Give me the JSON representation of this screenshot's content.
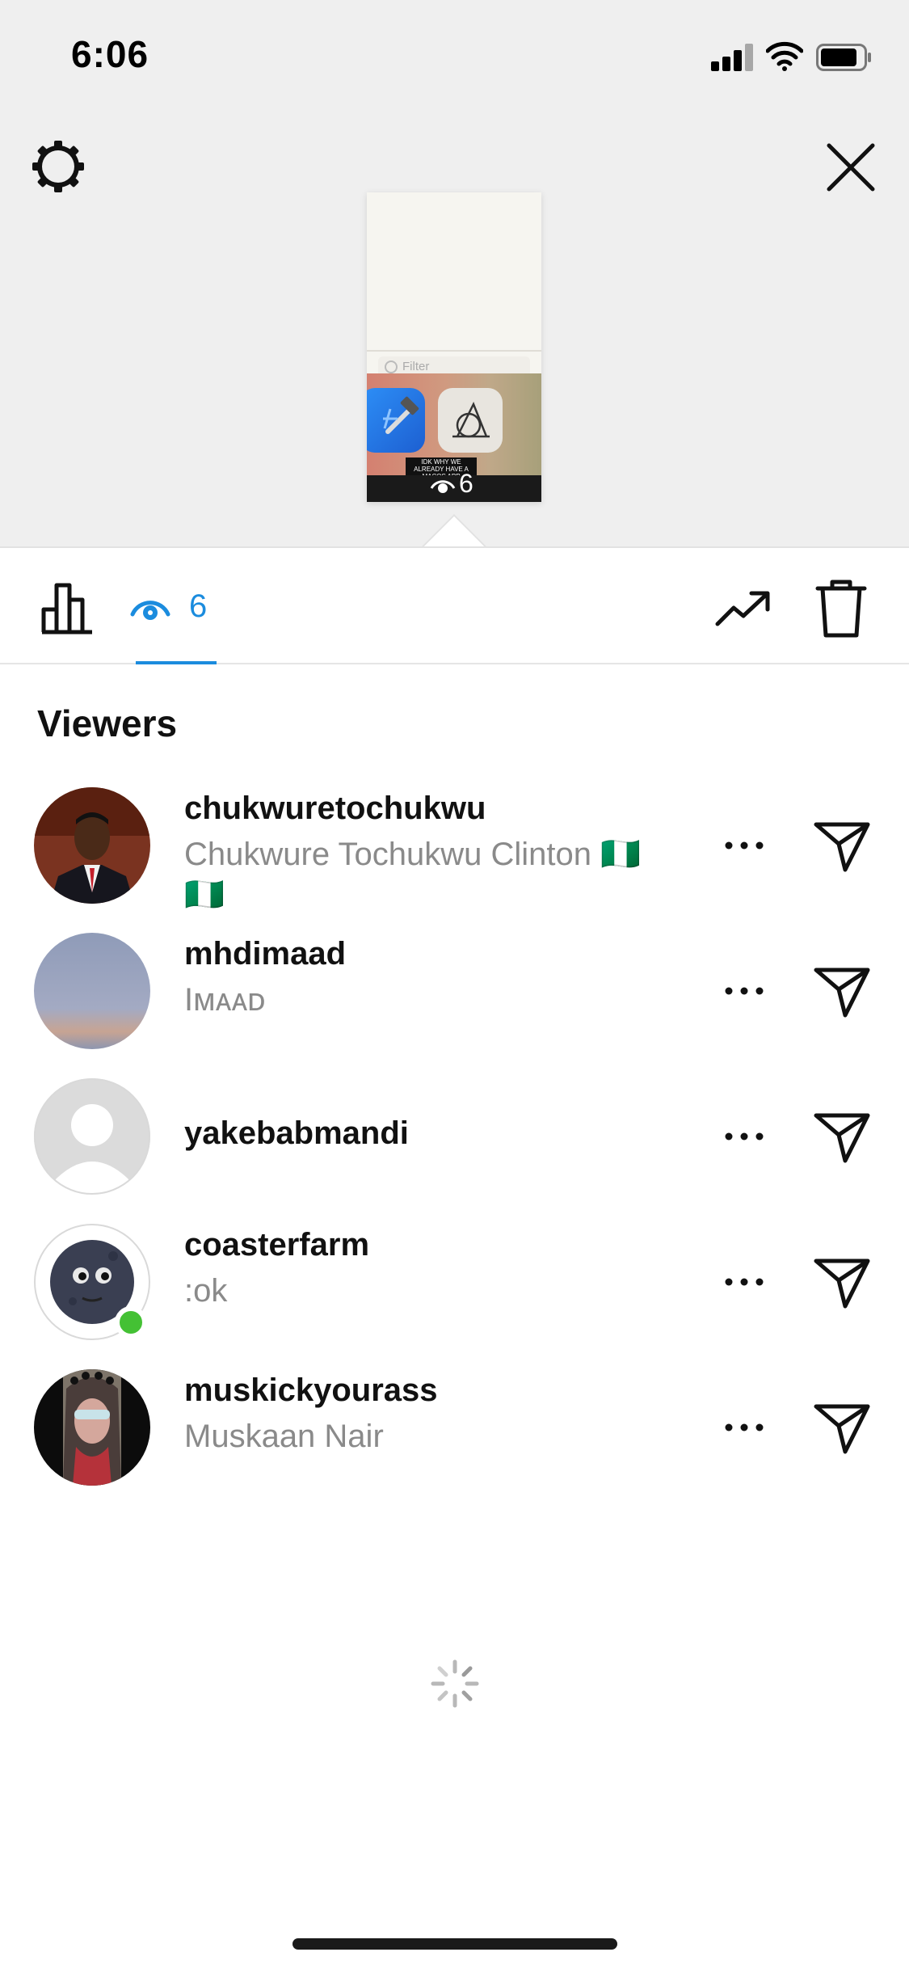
{
  "status_bar": {
    "time": "6:06"
  },
  "header": {
    "settings_icon": "gear-icon",
    "close_icon": "close-icon"
  },
  "story_preview": {
    "filter_placeholder": "Filter",
    "caption": "IDK WHY WE ALREADY HAVE A MACOS APP",
    "view_count": "6"
  },
  "tabs": {
    "viewers_count": "6",
    "active_color": "#1b8cde"
  },
  "viewers": {
    "title": "Viewers",
    "items": [
      {
        "username": "chukwuretochukwu",
        "full_name": "Chukwure Tochukwu Clinton 🇳🇬 🇳🇬",
        "online": false
      },
      {
        "username": "mhdimaad",
        "full_name": "Iᴍᴀᴀᴅ",
        "online": false
      },
      {
        "username": "yakebabmandi",
        "full_name": "",
        "online": false
      },
      {
        "username": "coasterfarm",
        "full_name": ":ok",
        "online": true
      },
      {
        "username": "muskickyourass",
        "full_name": "Muskaan Nair",
        "online": false
      }
    ]
  },
  "colors": {
    "accent": "#1b8cde",
    "online": "#44c134",
    "secondary_text": "#8a8a8a"
  }
}
